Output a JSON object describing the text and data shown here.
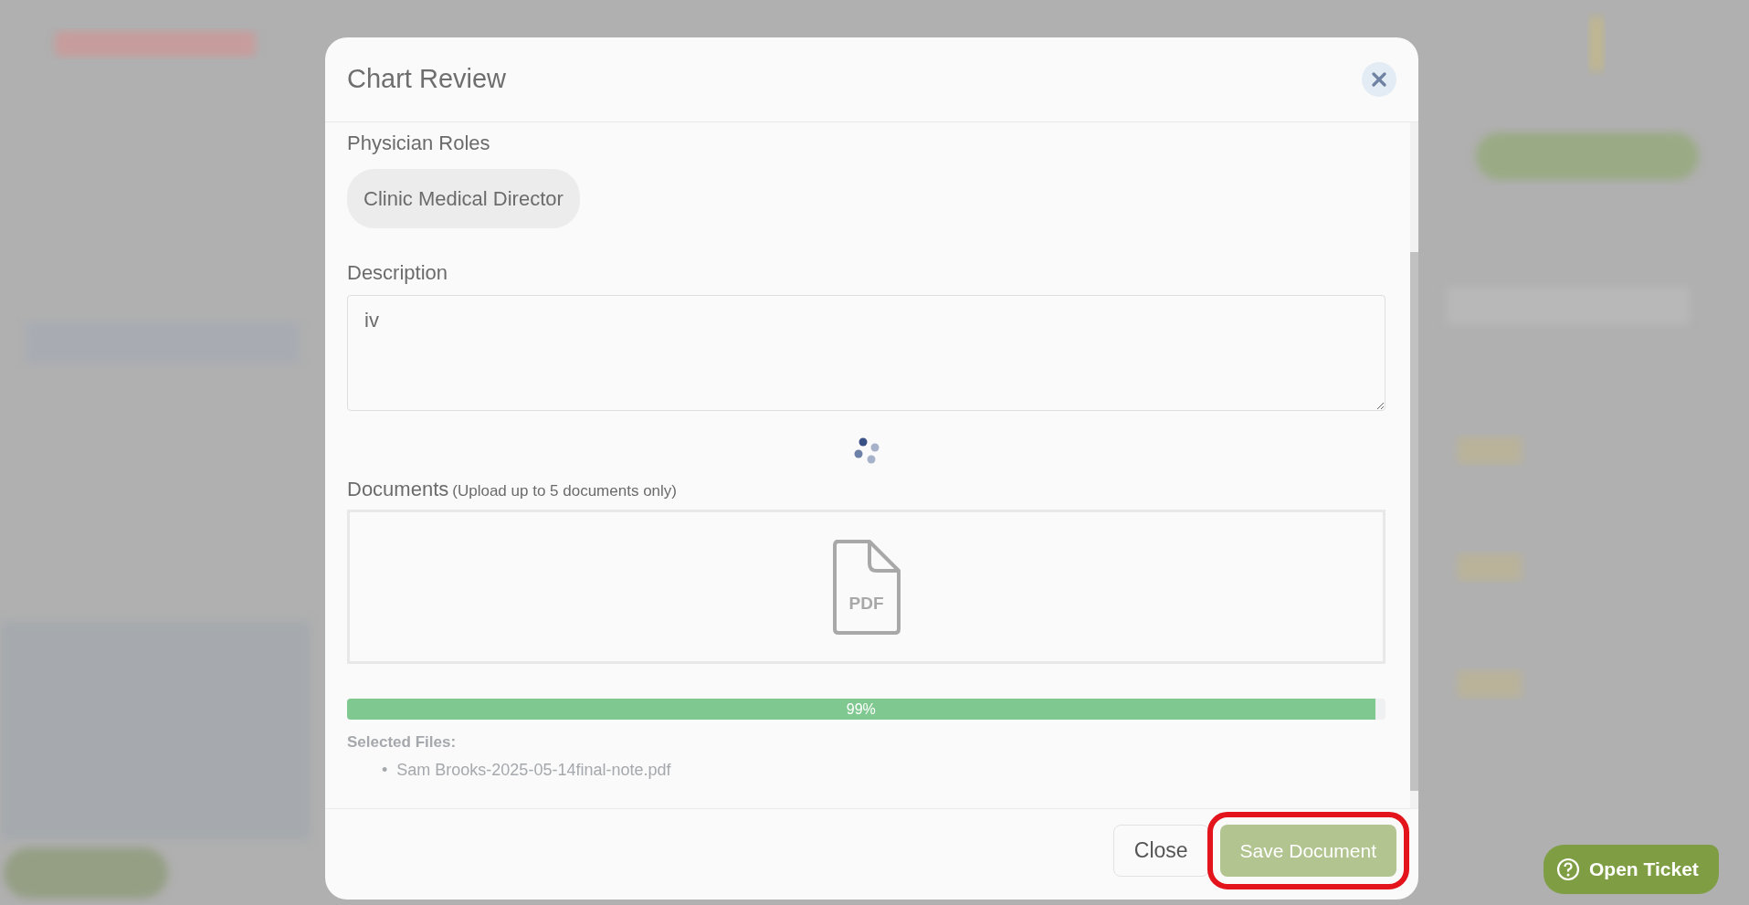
{
  "dialog": {
    "title": "Chart Review",
    "physician_roles": {
      "label": "Physician Roles",
      "chips": [
        "Clinic Medical Director"
      ]
    },
    "description": {
      "label": "Description",
      "value": "iv"
    },
    "documents": {
      "label": "Documents",
      "hint": "(Upload up to 5 documents only)",
      "file_type": "PDF"
    },
    "upload": {
      "level": 0.99,
      "reading": "99%"
    },
    "selected_files": {
      "label": "Selected Files:",
      "files": [
        {
          "marker": "•",
          "name": "Sam Brooks-2025-05-14final-note.pdf"
        }
      ]
    },
    "buttons": [
      {
        "kind": "secondary",
        "label": "Close",
        "highlighted": false
      },
      {
        "kind": "primary",
        "label": "Save Document",
        "highlighted": true
      }
    ]
  },
  "help_button": {
    "label": "Open Ticket"
  }
}
